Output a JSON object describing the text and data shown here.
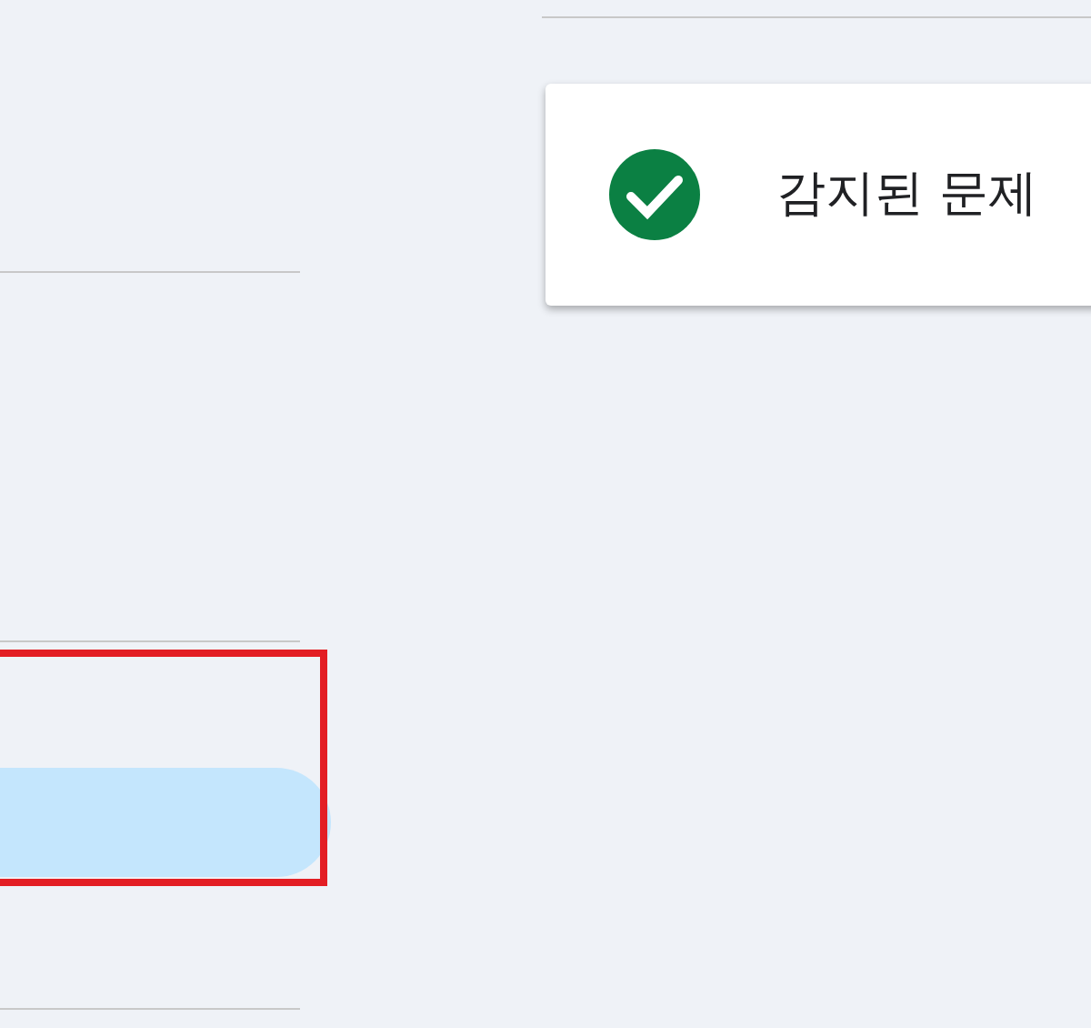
{
  "sidebar": {
    "items": [
      {
        "selected": false
      },
      {
        "selected": false
      },
      {
        "selected": true
      }
    ],
    "highlight_box": true
  },
  "status_card": {
    "kind": "success",
    "message": "감지된 문제"
  }
}
